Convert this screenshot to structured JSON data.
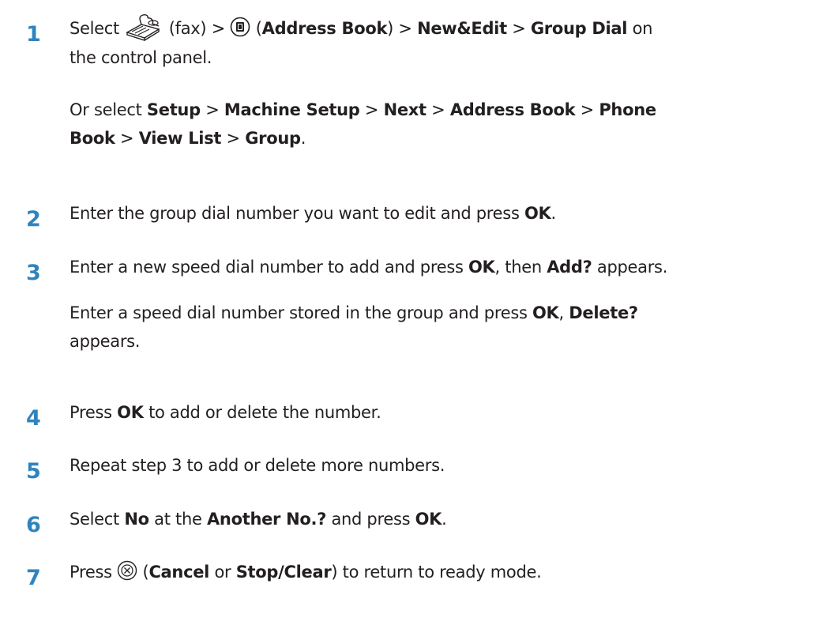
{
  "steps": [
    {
      "number": "1",
      "lines": [
        {
          "a": "Select ",
          "fax_label": " (fax) > ",
          "ab_open": " (",
          "address_book": "Address Book",
          "sep1": ") > ",
          "new_edit": "New&Edit",
          "sep2": " > ",
          "group_dial": "Group Dial",
          "tail": " on"
        },
        {
          "text": "the control panel."
        }
      ],
      "alt": {
        "a": "Or select ",
        "setup": "Setup",
        "s1": " > ",
        "machine_setup": "Machine Setup",
        "s2": " > ",
        "next": "Next",
        "s3": " > ",
        "address_book": "Address Book",
        "s4": " > ",
        "phone": "Phone",
        "book": "Book",
        "s5": " > ",
        "view_list": "View List",
        "s6": " > ",
        "group": "Group",
        "end": "."
      }
    },
    {
      "number": "2",
      "a": "Enter the group dial number you want to edit and press ",
      "ok": "OK",
      "end": "."
    },
    {
      "number": "3",
      "a": "Enter a new speed dial number to add and press ",
      "ok": "OK",
      "b": ", then ",
      "add": "Add?",
      "c": " appears.",
      "second": {
        "a": "Enter a speed dial number stored in the group and press ",
        "ok": "OK",
        "b": ", ",
        "delete": "Delete?",
        "c": "appears."
      }
    },
    {
      "number": "4",
      "a": "Press ",
      "ok": "OK",
      "b": " to add or delete the number."
    },
    {
      "number": "5",
      "a": "Repeat step 3 to add or delete more numbers."
    },
    {
      "number": "6",
      "a": "Select ",
      "no": "No",
      "b": " at the ",
      "another": "Another No.?",
      "c": " and press ",
      "ok": "OK",
      "end": "."
    },
    {
      "number": "7",
      "a": "Press ",
      "b": " (",
      "cancel": "Cancel",
      "or": " or ",
      "stop_clear": "Stop/Clear",
      "c": ") to return to ready mode."
    }
  ],
  "icons": {
    "fax": "fax-icon",
    "address_book": "address-book-icon",
    "cancel": "cancel-icon"
  },
  "colors": {
    "step_number": "#2f84be",
    "text": "#231f20"
  }
}
